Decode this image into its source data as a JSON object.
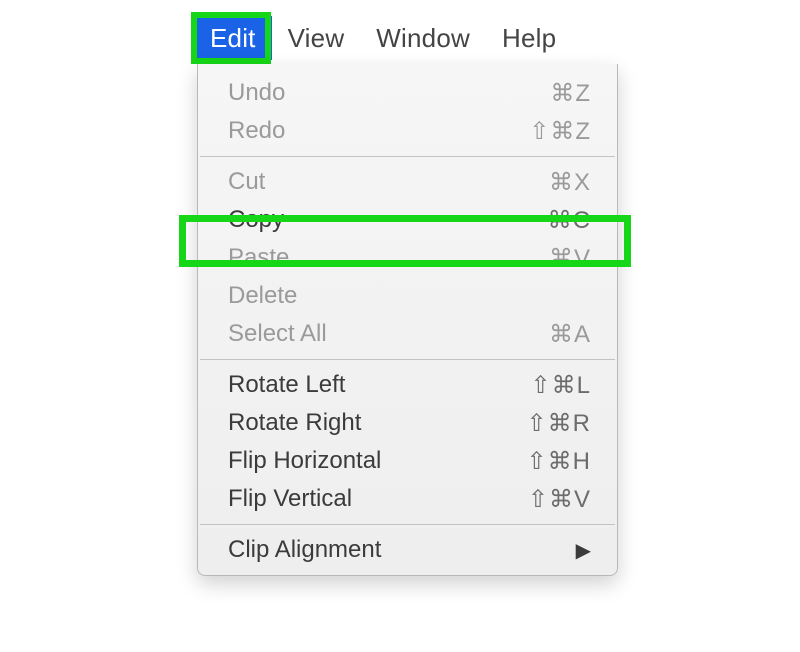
{
  "menubar": {
    "edit": "Edit",
    "view": "View",
    "window": "Window",
    "help": "Help"
  },
  "menu": {
    "undo": {
      "label": "Undo",
      "shortcut": "⌘Z"
    },
    "redo": {
      "label": "Redo",
      "shortcut": "⇧⌘Z"
    },
    "cut": {
      "label": "Cut",
      "shortcut": "⌘X"
    },
    "copy": {
      "label": "Copy",
      "shortcut": "⌘C"
    },
    "paste": {
      "label": "Paste",
      "shortcut": "⌘V"
    },
    "delete": {
      "label": "Delete",
      "shortcut": ""
    },
    "select_all": {
      "label": "Select All",
      "shortcut": "⌘A"
    },
    "rotate_left": {
      "label": "Rotate Left",
      "shortcut": "⇧⌘L"
    },
    "rotate_right": {
      "label": "Rotate Right",
      "shortcut": "⇧⌘R"
    },
    "flip_horizontal": {
      "label": "Flip Horizontal",
      "shortcut": "⇧⌘H"
    },
    "flip_vertical": {
      "label": "Flip Vertical",
      "shortcut": "⇧⌘V"
    },
    "clip_alignment": {
      "label": "Clip Alignment",
      "arrow": "▶"
    }
  },
  "highlight_color": "#15d617",
  "menubar_active_bg": "#1a63e6"
}
